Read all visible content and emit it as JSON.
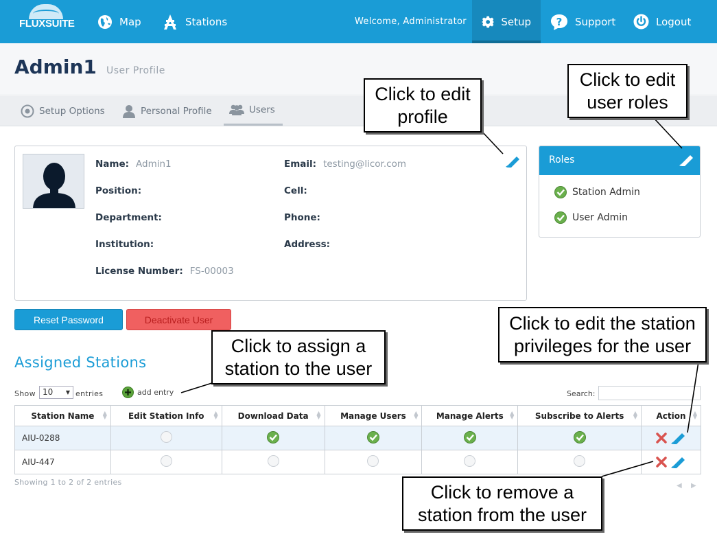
{
  "app": {
    "logo_text": "FLUXSUITE"
  },
  "nav": {
    "map": "Map",
    "stations": "Stations",
    "welcome": "Welcome, Administrator",
    "setup": "Setup",
    "support": "Support",
    "logout": "Logout"
  },
  "header": {
    "title": "Admin1",
    "subtitle": "User Profile"
  },
  "tabs": [
    {
      "label": "Setup Options"
    },
    {
      "label": "Personal Profile"
    },
    {
      "label": "Users"
    }
  ],
  "profile": {
    "name_label": "Name:",
    "name_value": "Admin1",
    "email_label": "Email:",
    "email_value": "testing@licor.com",
    "position_label": "Position:",
    "cell_label": "Cell:",
    "department_label": "Department:",
    "phone_label": "Phone:",
    "institution_label": "Institution:",
    "address_label": "Address:",
    "license_label": "License Number:",
    "license_value": "FS-00003"
  },
  "roles": {
    "title": "Roles",
    "items": [
      "Station Admin",
      "User Admin"
    ]
  },
  "buttons": {
    "reset_password": "Reset Password",
    "deactivate_user": "Deactivate User"
  },
  "stations": {
    "title": "Assigned Stations",
    "show_label": "Show",
    "entries_value": "10",
    "entries_label": "entries",
    "add_entry": "add entry",
    "search_label": "Search:",
    "columns": [
      "Station Name",
      "Edit Station Info",
      "Download Data",
      "Manage Users",
      "Manage Alerts",
      "Subscribe to Alerts",
      "Action"
    ],
    "rows": [
      {
        "name": "AIU-0288",
        "edit_info": false,
        "download": true,
        "manage_users": true,
        "manage_alerts": true,
        "subscribe": true
      },
      {
        "name": "AIU-447",
        "edit_info": false,
        "download": false,
        "manage_users": false,
        "manage_alerts": false,
        "subscribe": false
      }
    ],
    "info": "Showing 1 to 2 of 2 entries"
  },
  "callouts": {
    "edit_profile": "Click to edit profile",
    "edit_roles": "Click to edit user roles",
    "assign_station": "Click to assign a station to the user",
    "edit_privileges": "Click to edit the station privileges for the user",
    "remove_station": "Click to remove a station from the user"
  },
  "colors": {
    "brand_blue": "#1a9cd6",
    "check_green": "#6ab04c",
    "remove_red": "#d9534f",
    "title_navy": "#1d3557"
  }
}
